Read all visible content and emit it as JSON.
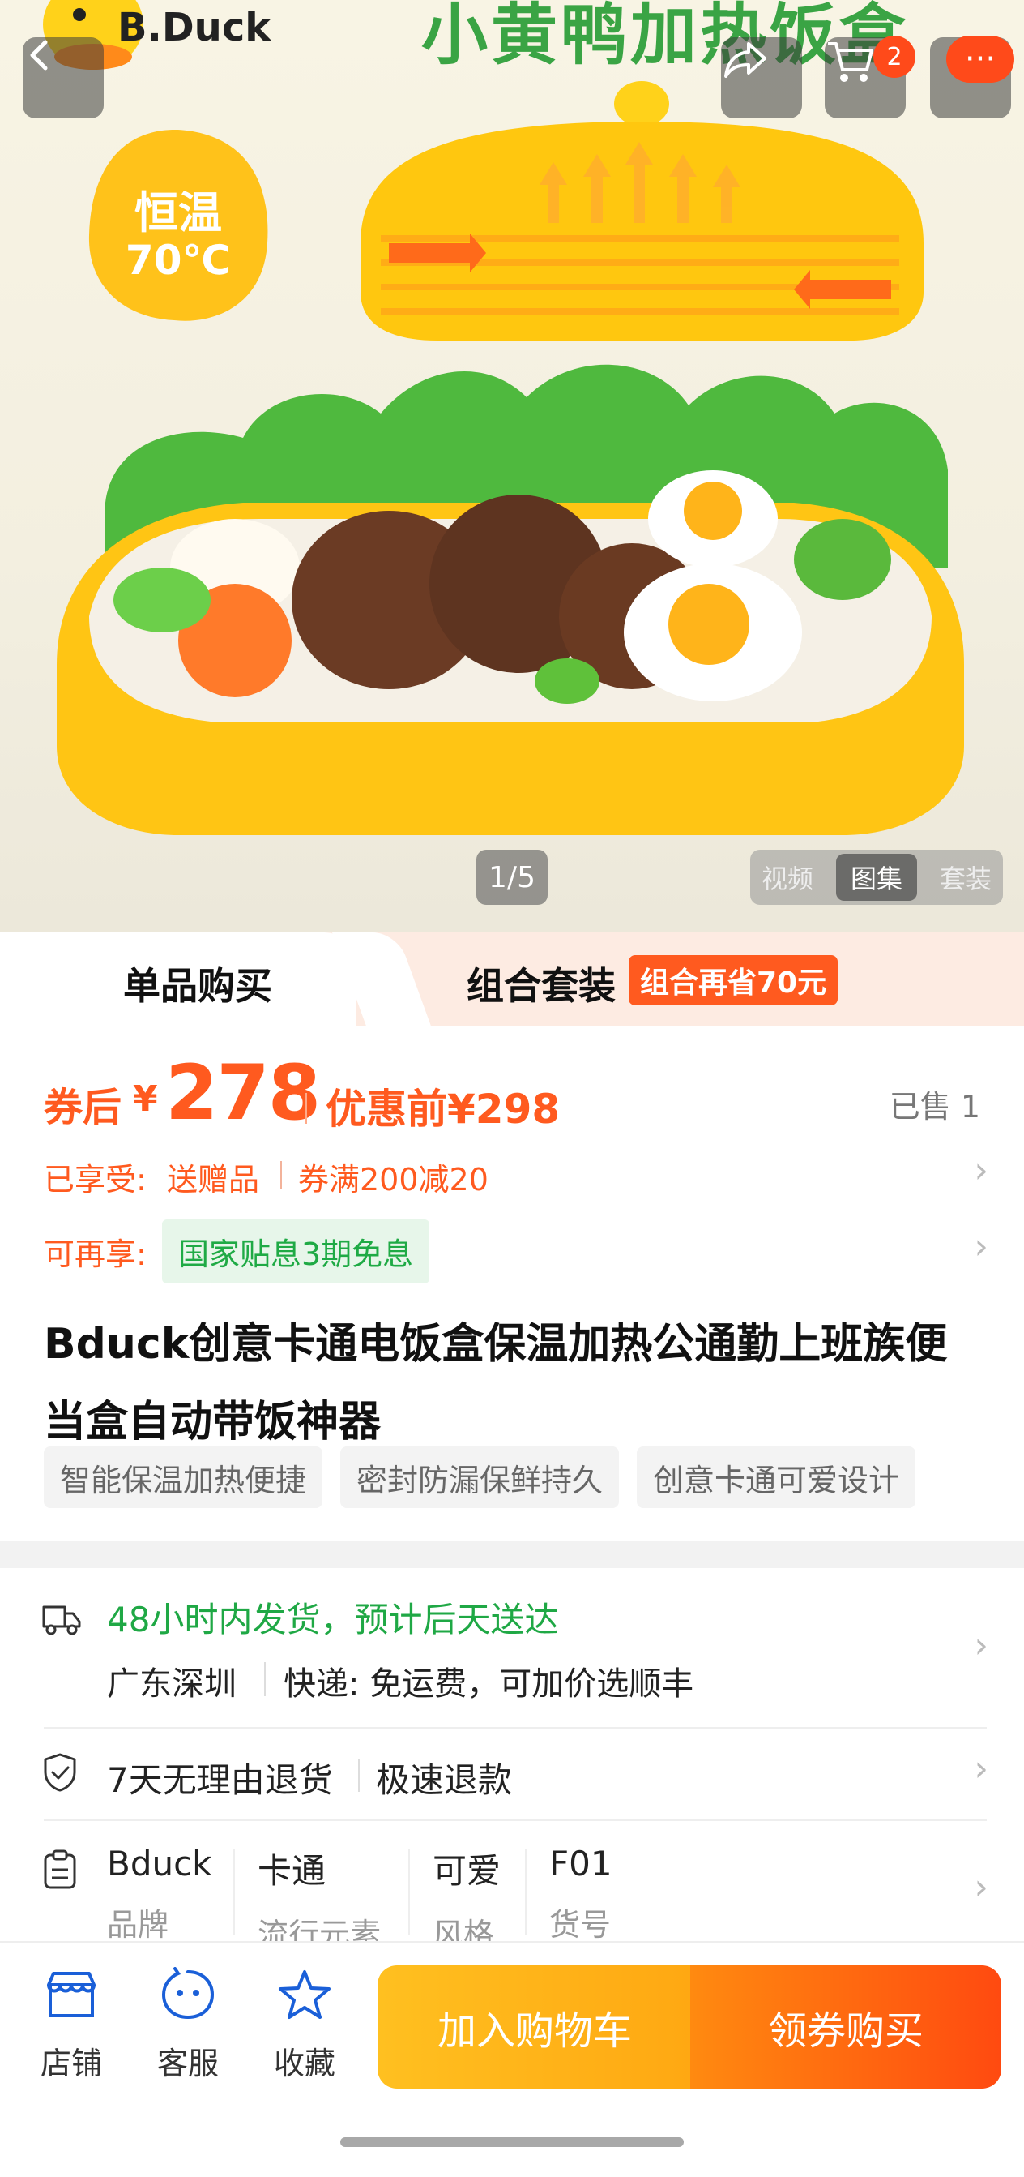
{
  "hero": {
    "brand": "B.Duck",
    "headline": "小黄鸭加热饭盒",
    "badge_line1": "恒温",
    "badge_line2": "70℃",
    "cart_count": "2",
    "more_label": "···",
    "pager": "1/5",
    "media_tabs": [
      "视频",
      "图集",
      "套装"
    ],
    "media_tab_selected": "图集"
  },
  "buy_tabs": {
    "single": "单品购买",
    "bundle": "组合套装",
    "bundle_tag": "组合再省70元"
  },
  "price": {
    "label": "券后",
    "currency": "¥",
    "value": "278",
    "original": "优惠前¥298",
    "sold": "已售 1"
  },
  "promos": {
    "enjoyed_label": "已享受:",
    "enjoyed_gift": "送赠品",
    "enjoyed_coupon": "券满200减20",
    "more_label": "可再享:",
    "subsidy": "国家贴息3期免息"
  },
  "product": {
    "title": "Bduck创意卡通电饭盒保温加热公通勤上班族便当盒自动带饭神器",
    "tags": [
      "智能保温加热便捷",
      "密封防漏保鲜持久",
      "创意卡通可爱设计"
    ]
  },
  "shipping": {
    "promise": "48小时内发货，预计后天送达",
    "origin": "广东深圳",
    "express": "快递: 免运费，可加价选顺丰"
  },
  "returns": {
    "policy": "7天无理由退货",
    "refund": "极速退款"
  },
  "attributes": [
    {
      "value": "Bduck",
      "key": "品牌"
    },
    {
      "value": "卡通",
      "key": "流行元素"
    },
    {
      "value": "可爱",
      "key": "风格"
    },
    {
      "value": "F01",
      "key": "货号"
    }
  ],
  "bottom_bar": {
    "store": "店铺",
    "service": "客服",
    "favorite": "收藏",
    "add_cart": "加入购物车",
    "buy": "领券购买"
  },
  "colors": {
    "accent": "#ff5a1f",
    "green": "#1fa845",
    "cart_btn": "#ffb018",
    "buy_btn": "#ff5a10"
  }
}
